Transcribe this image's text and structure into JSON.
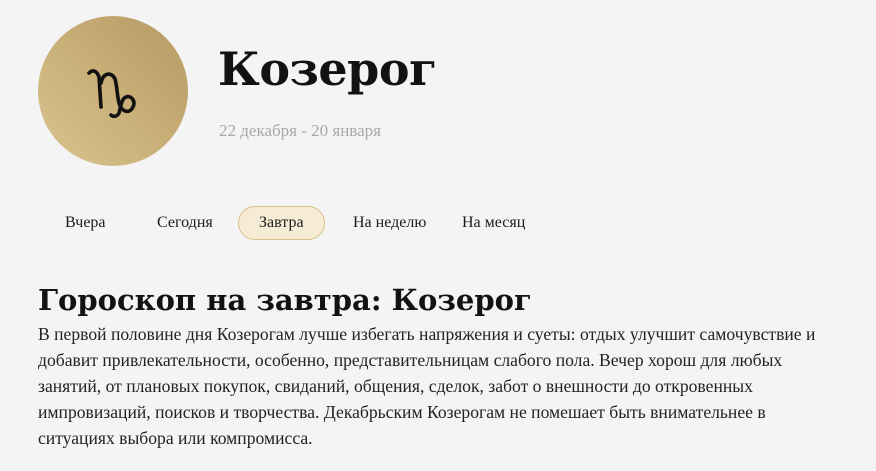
{
  "sign": {
    "icon": "capricorn-icon",
    "name": "Козерог",
    "dates": "22 декабря - 20 января"
  },
  "tabs": [
    {
      "label": "Вчера",
      "active": false
    },
    {
      "label": "Сегодня",
      "active": false
    },
    {
      "label": "Завтра",
      "active": true
    },
    {
      "label": "На неделю",
      "active": false
    },
    {
      "label": "На месяц",
      "active": false
    }
  ],
  "content": {
    "title": "Гороскоп на завтра: Козерог",
    "text": "В первой половине дня Козерогам лучше избегать напряжения и суеты: отдых улучшит самочувствие и добавит привлекательности, особенно, представительницам слабого пола. Вечер хорош для любых занятий, от плановых покупок, свиданий, общения, сделок, забот о внешности до откровенных импровизаций, поисков и творчества. Декабрьским Козерогам не помешает быть внимательнее в ситуациях выбора или компромисса."
  },
  "colors": {
    "accent": "#c7ad75",
    "accent_light": "#f6ecd6",
    "accent_border": "#d8be84",
    "background": "#f4f4f5",
    "muted_text": "#a8a8a8"
  }
}
